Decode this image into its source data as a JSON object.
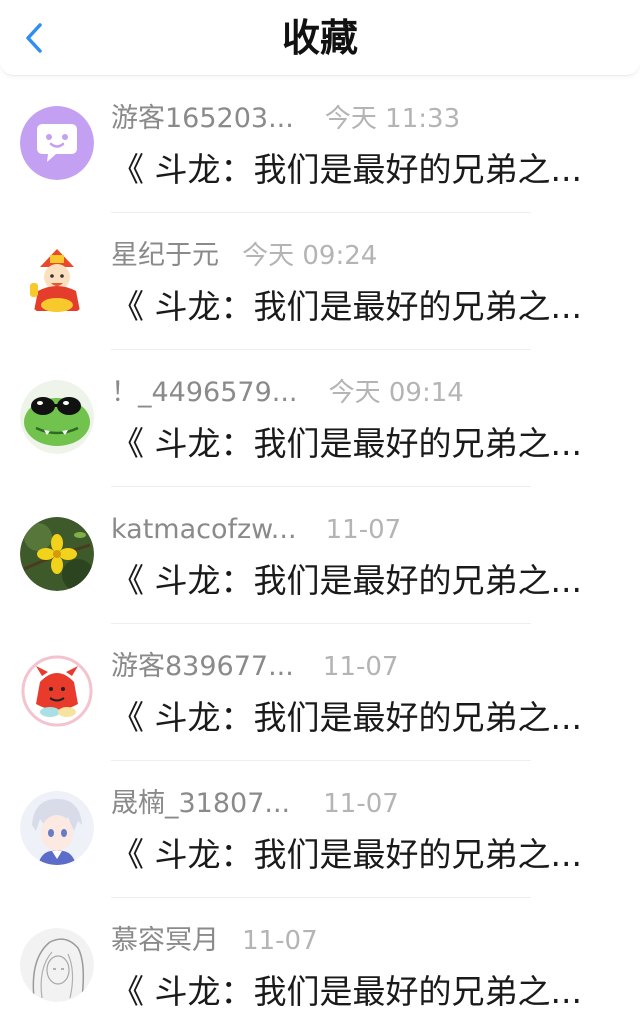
{
  "header": {
    "title": "收藏",
    "back_icon": "chevron-left-icon",
    "accent_color": "#2e8ff0"
  },
  "items": [
    {
      "username": "游客165203...",
      "time": "今天 11:33",
      "snippet": "《 斗龙：我们是最好的兄弟之...",
      "avatar": "chat-bubble-avatar"
    },
    {
      "username": "星纪于元",
      "time": "今天 09:24",
      "snippet": "《 斗龙：我们是最好的兄弟之...",
      "avatar": "fortune-god-avatar"
    },
    {
      "username": "！_4496579...",
      "time": "今天 09:14",
      "snippet": "《 斗龙：我们是最好的兄弟之...",
      "avatar": "crocodile-sunglasses-avatar"
    },
    {
      "username": "katmacofzw...",
      "time": "11-07",
      "snippet": "《 斗龙：我们是最好的兄弟之...",
      "avatar": "yellow-flower-avatar"
    },
    {
      "username": "游客839677...",
      "time": "11-07",
      "snippet": "《 斗龙：我们是最好的兄弟之...",
      "avatar": "red-monster-avatar"
    },
    {
      "username": "晟楠_31807...",
      "time": "11-07",
      "snippet": "《 斗龙：我们是最好的兄弟之...",
      "avatar": "anime-boy-avatar"
    },
    {
      "username": "慕容冥月",
      "time": "11-07",
      "snippet": "《 斗龙：我们是最好的兄弟之...",
      "avatar": "sketch-girl-avatar"
    }
  ]
}
